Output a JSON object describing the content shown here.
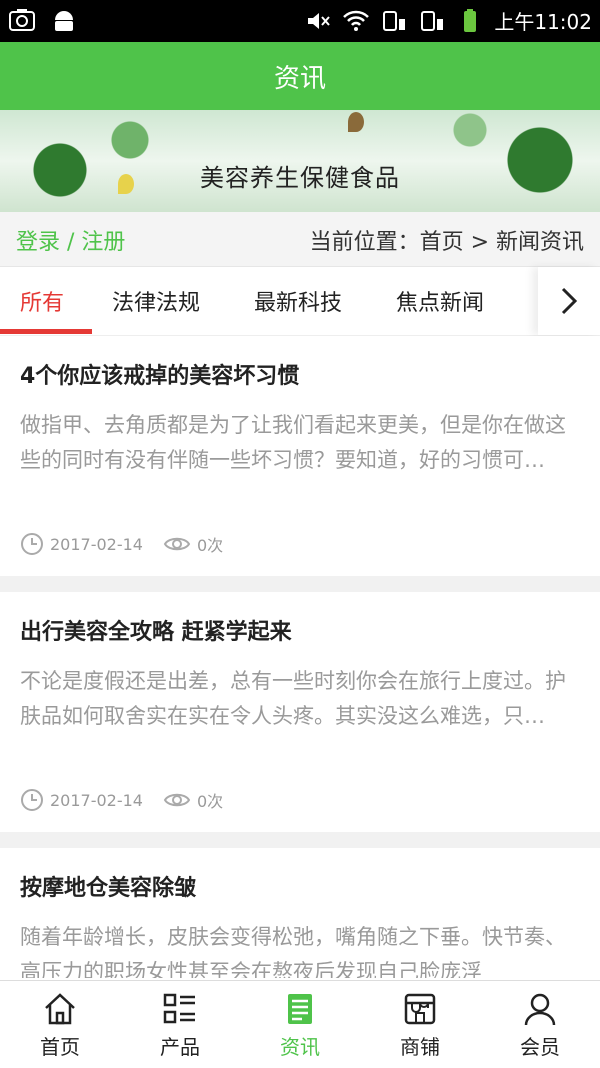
{
  "status_bar": {
    "time": "上午11:02"
  },
  "header": {
    "title": "资讯"
  },
  "banner": {
    "title": "美容养生保健食品"
  },
  "crumbbar": {
    "login_link": "登录 / 注册",
    "breadcrumb": "当前位置：首页 > 新闻资讯"
  },
  "tabs": [
    {
      "label": "所有"
    },
    {
      "label": "法律法规"
    },
    {
      "label": "最新科技"
    },
    {
      "label": "焦点新闻"
    }
  ],
  "articles": [
    {
      "title": "4个你应该戒掉的美容坏习惯",
      "summary": "做指甲、去角质都是为了让我们看起来更美，但是你在做这些的同时有没有伴随一些坏习惯？要知道，好的习惯可…",
      "date": "2017-02-14",
      "views": "0次"
    },
    {
      "title": "出行美容全攻略 赶紧学起来",
      "summary": "不论是度假还是出差，总有一些时刻你会在旅行上度过。护肤品如何取舍实在实在令人头疼。其实没这么难选，只…",
      "date": "2017-02-14",
      "views": "0次"
    },
    {
      "title": "按摩地仓美容除皱",
      "summary": "随着年龄增长，皮肤会变得松弛，嘴角随之下垂。快节奏、高压力的职场女性甚至会在熬夜后发现自己脸庞浮",
      "date": "",
      "views": ""
    }
  ],
  "bottom_nav": [
    {
      "label": "首页",
      "icon": "home-icon"
    },
    {
      "label": "产品",
      "icon": "product-list-icon"
    },
    {
      "label": "资讯",
      "icon": "news-icon"
    },
    {
      "label": "商铺",
      "icon": "shop-icon"
    },
    {
      "label": "会员",
      "icon": "member-icon"
    }
  ],
  "colors": {
    "primary_green": "#4fc34a",
    "active_red": "#e53935",
    "muted_text": "#9a9a9a"
  }
}
